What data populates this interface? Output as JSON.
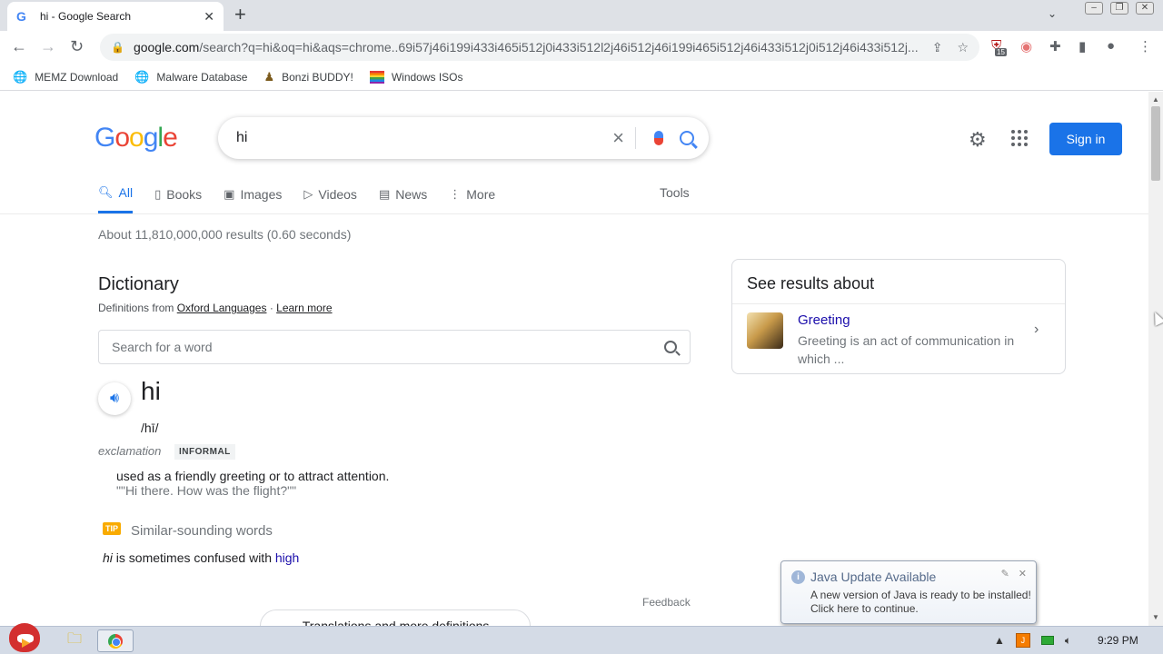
{
  "browser": {
    "tab_title": "hi - Google Search",
    "tab_favicon": "G",
    "url_host": "google.com",
    "url_path": "/search?q=hi&oq=hi&aqs=chrome..69i57j46i199i433i465i512j0i433i512l2j46i512j46i199i465i512j46i433i512j0i512j46i433i512j...",
    "extension_badge": "15"
  },
  "bookmarks": [
    {
      "label": "MEMZ Download",
      "icon": "globe-icon"
    },
    {
      "label": "Malware Database",
      "icon": "globe-icon"
    },
    {
      "label": "Bonzi BUDDY!",
      "icon": "bonzi-icon"
    },
    {
      "label": "Windows ISOs",
      "icon": "rainbow-flag-icon"
    }
  ],
  "header": {
    "logo": [
      "G",
      "o",
      "o",
      "g",
      "l",
      "e"
    ],
    "query": "hi",
    "signin_label": "Sign in"
  },
  "tabs": {
    "items": [
      "All",
      "Books",
      "Images",
      "Videos",
      "News",
      "More"
    ],
    "tools": "Tools"
  },
  "results": {
    "stats": "About 11,810,000,000 results (0.60 seconds)"
  },
  "dictionary": {
    "title": "Dictionary",
    "source_prefix": "Definitions from",
    "source_link": "Oxford Languages",
    "separator": "·",
    "learn_more": "Learn more",
    "search_placeholder": "Search for a word",
    "headword": "hi",
    "phonetic": "/hī/",
    "part_of_speech": "exclamation",
    "register": "INFORMAL",
    "definition": "used as a friendly greeting or to attract attention.",
    "example": "\"\"Hi there. How was the flight?\"\"",
    "tip_badge": "TIP",
    "similar_heading": "Similar-sounding words",
    "confused_word": "hi",
    "confused_text": " is sometimes confused with ",
    "confused_link": "high",
    "feedback": "Feedback",
    "translations": "Translations and more definitions"
  },
  "knowledge_panel": {
    "title": "See results about",
    "name": "Greeting",
    "description": "Greeting is an act of communication in which ..."
  },
  "java_popup": {
    "title": "Java Update Available",
    "message": "A new version of Java is ready to be installed! Click here to continue."
  },
  "taskbar": {
    "clock": "9:29 PM"
  },
  "colors": {
    "accent": "#1a73e8",
    "link": "#1a0dab",
    "tip": "#f9ab00"
  }
}
